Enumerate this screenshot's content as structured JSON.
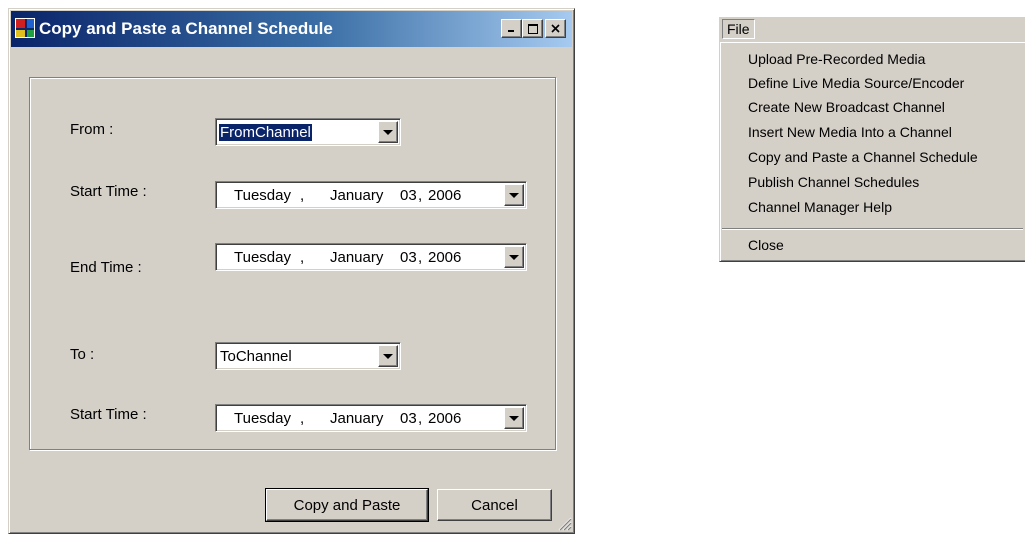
{
  "dialog": {
    "title": "Copy and Paste a Channel Schedule",
    "minimize_label": "_",
    "from_label": "From :",
    "from_channel": "FromChannel",
    "start_time_label": "Start Time :",
    "start_date": {
      "day": "Tuesday",
      "sep": ",",
      "month": "January",
      "date": "03",
      "year": "2006"
    },
    "end_time_label": "End Time :",
    "end_date": {
      "day": "Tuesday",
      "sep": ",",
      "month": "January",
      "date": "03",
      "year": "2006"
    },
    "to_label": "To :",
    "to_channel": "ToChannel",
    "to_start_time_label": "Start Time :",
    "to_start_date": {
      "day": "Tuesday",
      "sep": ",",
      "month": "January",
      "date": "03",
      "year": "2006"
    },
    "copy_paste_button": "Copy and  Paste",
    "cancel_button": "Cancel"
  },
  "menu": {
    "file_label": "File",
    "items": [
      "Upload Pre-Recorded Media",
      "Define Live Media Source/Encoder",
      "Create New Broadcast Channel",
      "Insert New Media Into a Channel",
      "Copy and Paste a Channel Schedule",
      "Publish Channel Schedules",
      "Channel Manager Help"
    ],
    "close_label": "Close"
  },
  "colors": {
    "face": "#d4d0c8",
    "title_active": "#0a246a",
    "title_gradient_end": "#a6caf0",
    "selection": "#0a246a"
  }
}
